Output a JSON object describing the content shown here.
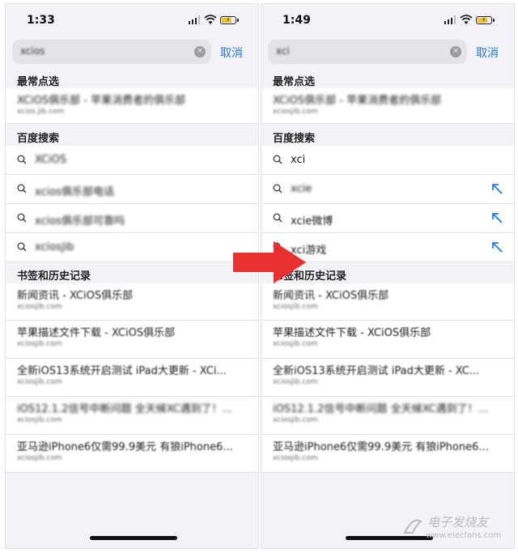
{
  "left": {
    "time": "1:33",
    "query": "xcios",
    "cancel": "取消",
    "sec_top": "最常点选",
    "top_hit": {
      "title": "XCiOS俱乐部 - 苹果消费者的俱乐部",
      "url": "xcios.jib.com"
    },
    "sec_search": "百度搜索",
    "suggestions": [
      "XCiOS",
      "xcios俱乐部电话",
      "xcios俱乐部可靠吗",
      "xciosjib"
    ],
    "sec_history": "书签和历史记录",
    "history": [
      {
        "title": "新闻资讯 - XCiOS俱乐部",
        "url": "xciosjib.com"
      },
      {
        "title": "苹果描述文件下载 - XCiOS俱乐部",
        "url": "xciosjib.com"
      },
      {
        "title": "全新iOS13系统开启测试 iPad大更新 - XCi...",
        "url": "xciosjib.com"
      },
      {
        "title": "iOS12.1.2信号中断问题 全天候XC遇到了！...",
        "url": "xciosjib.com"
      },
      {
        "title": "亚马逊iPhone6仅需99.9美元 有狼iPhone6...",
        "url": "xciosjib.com"
      }
    ]
  },
  "right": {
    "time": "1:49",
    "query": "xci",
    "cancel": "取消",
    "sec_top": "最常点选",
    "top_hit": {
      "title": "XCiOS俱乐部 - 苹果消费者的俱乐部",
      "url": "xciosjib.com"
    },
    "sec_search": "百度搜索",
    "suggestions": [
      "xci",
      "xcie",
      "xcie微博",
      "xci游戏"
    ],
    "sec_history": "书签和历史记录",
    "history": [
      {
        "title": "新闻资讯 - XCiOS俱乐部",
        "url": "xciosjib.com"
      },
      {
        "title": "苹果描述文件下载 - XCiOS俱乐部",
        "url": "xciosjib.com"
      },
      {
        "title": "全新iOS13系统开启测试 iPad大更新 - XC...",
        "url": "xciosjib.com"
      },
      {
        "title": "iOS12.1.2信号中断问题 全天候XC遇到了！...",
        "url": "xciosjib.com"
      },
      {
        "title": "亚马逊iPhone6仅需99.9美元 有狼iPhone6...",
        "url": "xciosjib.com"
      }
    ]
  },
  "watermark": {
    "line1": "电子发烧友",
    "line2": "www.elecfans.com"
  },
  "colors": {
    "accent": "#1a7cf0",
    "arrow": "#e8312f",
    "battery": "#f4c21a"
  }
}
